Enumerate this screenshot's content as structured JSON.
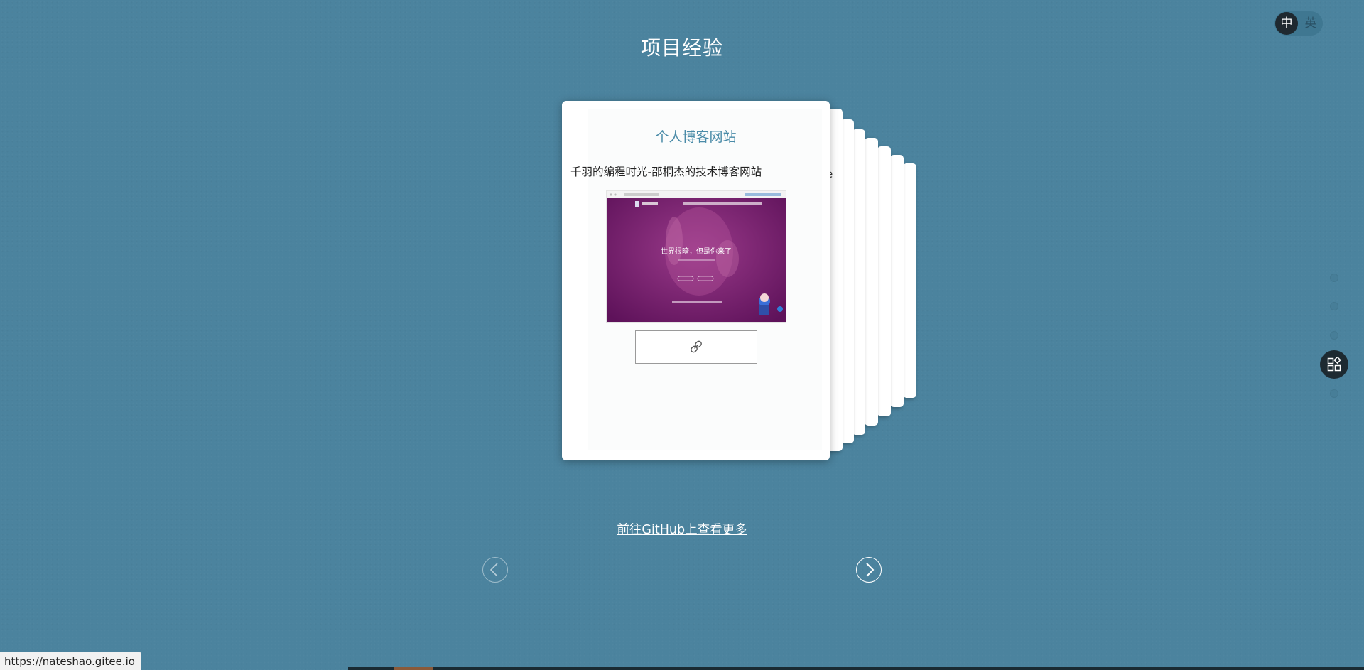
{
  "lang_toggle": {
    "zh": "中",
    "en": "英",
    "active": "zh"
  },
  "page_title": "项目经验",
  "card": {
    "title": "个人博客网站",
    "description": "千羽的编程时光-邵桐杰的技术博客网站",
    "preview": {
      "headline": "世界很暗，但是你来了",
      "background_color": "#7a1c6e"
    },
    "link_icon": "link-icon"
  },
  "card_stack_count": 8,
  "peek_text": "e",
  "github_link": "前往GitHub上查看更多",
  "nav": {
    "prev_icon": "chevron-left-icon",
    "next_icon": "chevron-right-icon"
  },
  "side_nav": {
    "dot_count": 5,
    "menu_icon": "apps-icon"
  },
  "status_url": "https://nateshao.gitee.io",
  "colors": {
    "background": "#4b839e",
    "card_title": "#4a8ba8",
    "toggle_active": "#1f2930"
  }
}
